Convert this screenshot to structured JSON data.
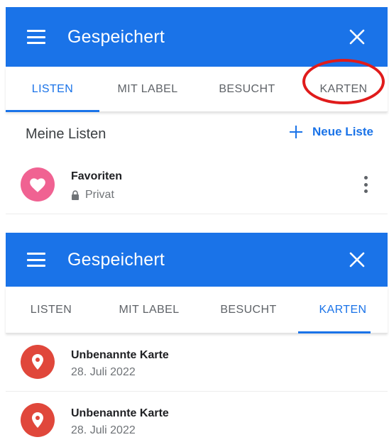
{
  "colors": {
    "primary": "#1a73e8",
    "highlight": "#e01b1b",
    "heart": "#f06292",
    "pin": "#e0473b"
  },
  "screens": [
    {
      "header": {
        "title": "Gespeichert",
        "menu_icon": "menu-icon",
        "close_icon": "close-icon"
      },
      "tabs": [
        {
          "label": "LISTEN",
          "active": true
        },
        {
          "label": "MIT LABEL",
          "active": false
        },
        {
          "label": "BESUCHT",
          "active": false
        },
        {
          "label": "KARTEN",
          "active": false,
          "highlighted": true
        }
      ],
      "section": {
        "title": "Meine Listen",
        "action": "Neue Liste"
      },
      "items": [
        {
          "title": "Favoriten",
          "subtitle": "Privat",
          "icon": "heart-icon",
          "meta_icon": "lock-icon",
          "menu": "more-vert-icon"
        }
      ]
    },
    {
      "header": {
        "title": "Gespeichert",
        "menu_icon": "menu-icon",
        "close_icon": "close-icon"
      },
      "tabs": [
        {
          "label": "LISTEN",
          "active": false
        },
        {
          "label": "MIT LABEL",
          "active": false
        },
        {
          "label": "BESUCHT",
          "active": false
        },
        {
          "label": "KARTEN",
          "active": true
        }
      ],
      "items": [
        {
          "title": "Unbenannte Karte",
          "subtitle": "28. Juli 2022",
          "icon": "map-pin-icon"
        },
        {
          "title": "Unbenannte Karte",
          "subtitle": "28. Juli 2022",
          "icon": "map-pin-icon"
        }
      ]
    }
  ]
}
